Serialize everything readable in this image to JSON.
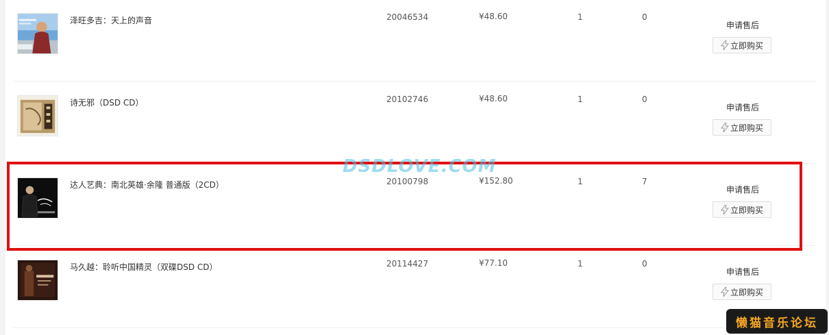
{
  "order_items": [
    {
      "name": "泽旺多吉：天上的声音",
      "sku": "20046534",
      "price": "¥48.60",
      "qty": "1",
      "count": "0",
      "after_sale": "申请售后",
      "buy": "立即购买",
      "cover_icon": "album-cover-singer-portrait"
    },
    {
      "name": "诗无邪（DSD CD）",
      "sku": "20102746",
      "price": "¥48.60",
      "qty": "1",
      "count": "0",
      "after_sale": "申请售后",
      "buy": "立即购买",
      "cover_icon": "album-cover-calligraphy"
    },
    {
      "name": "达人艺典：南北英雄·余隆 普通版（2CD）",
      "sku": "20100798",
      "price": "¥152.80",
      "qty": "1",
      "count": "7",
      "after_sale": "申请售后",
      "buy": "立即购买",
      "cover_icon": "album-cover-conductor"
    },
    {
      "name": "马久越：聆听中国精灵（双碟DSD CD）",
      "sku": "20114427",
      "price": "¥77.10",
      "qty": "1",
      "count": "0",
      "after_sale": "申请售后",
      "buy": "立即购买",
      "cover_icon": "album-cover-china"
    }
  ],
  "watermark": "DSDLOVE.COM",
  "forum_badge": "懒猫音乐论坛",
  "colors": {
    "highlight": "#e01010",
    "watermark": "#50bee6",
    "badge_text": "#f5a623",
    "badge_bg": "#1a1a1a"
  }
}
